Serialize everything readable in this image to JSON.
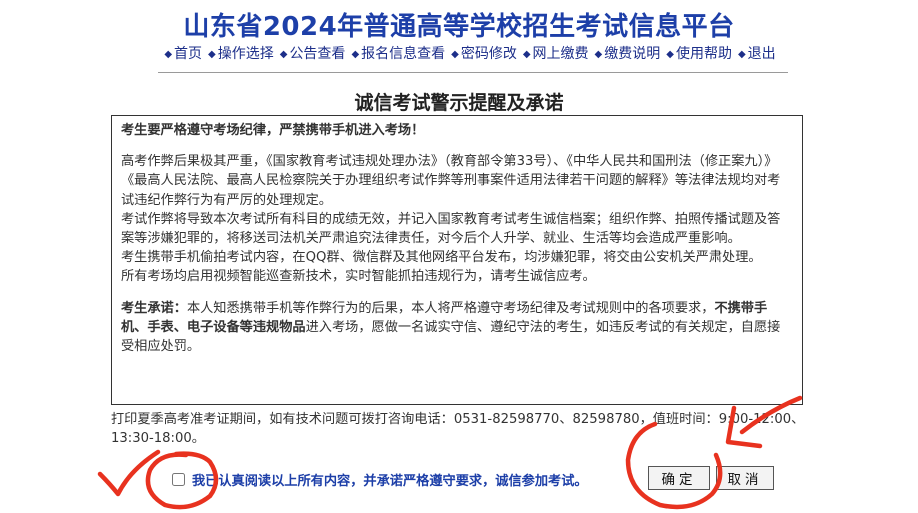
{
  "site_title": "山东省2024年普通高等学校招生考试信息平台",
  "nav": [
    {
      "label": "首页"
    },
    {
      "label": "操作选择"
    },
    {
      "label": "公告查看"
    },
    {
      "label": "报名信息查看"
    },
    {
      "label": "密码修改"
    },
    {
      "label": "网上缴费"
    },
    {
      "label": "缴费说明"
    },
    {
      "label": "使用帮助"
    },
    {
      "label": "退出"
    }
  ],
  "nav_bullet": "◆",
  "section_title": "诚信考试警示提醒及承诺",
  "notice": {
    "warning": "考生要严格遵守考场纪律，严禁携带手机进入考场！",
    "para1": "高考作弊后果极其严重，《国家教育考试违规处理办法》（教育部令第33号）、《中华人民共和国刑法（修正案九）》《最高人民法院、最高人民检察院关于办理组织考试作弊等刑事案件适用法律若干问题的解释》等法律法规均对考试违纪作弊行为有严厉的处理规定。",
    "para2": "考试作弊将导致本次考试所有科目的成绩无效，并记入国家教育考试考生诚信档案；组织作弊、拍照传播试题及答案等涉嫌犯罪的，将移送司法机关严肃追究法律责任，对今后个人升学、就业、生活等均会造成严重影响。",
    "para3": "考生携带手机偷拍考试内容，在QQ群、微信群及其他网络平台发布，均涉嫌犯罪，将交由公安机关严肃处理。",
    "para4": "所有考场均启用视频智能巡查新技术，实时智能抓拍违规行为，请考生诚信应考。",
    "commit_label": "考生承诺：",
    "commit_text1": "本人知悉携带手机等作弊行为的后果，本人将严格遵守考场纪律及考试规则中的各项要求，",
    "commit_bold": "不携带手机、手表、电子设备等违规物品",
    "commit_text2": "进入考场，愿做一名诚实守信、遵纪守法的考生，如违反考试的有关规定，自愿接受相应处罚。"
  },
  "contact_text": "打印夏季高考准考证期间，如有技术问题可拨打咨询电话：0531-82598770、82598780，值班时间：9:00-12:00、13:30-18:00。",
  "agree_label": "我已认真阅读以上所有内容，并承诺严格遵守要求，诚信参加考试。",
  "buttons": {
    "confirm": "确定",
    "cancel": "取消"
  },
  "annotation_color": "#e8321f"
}
